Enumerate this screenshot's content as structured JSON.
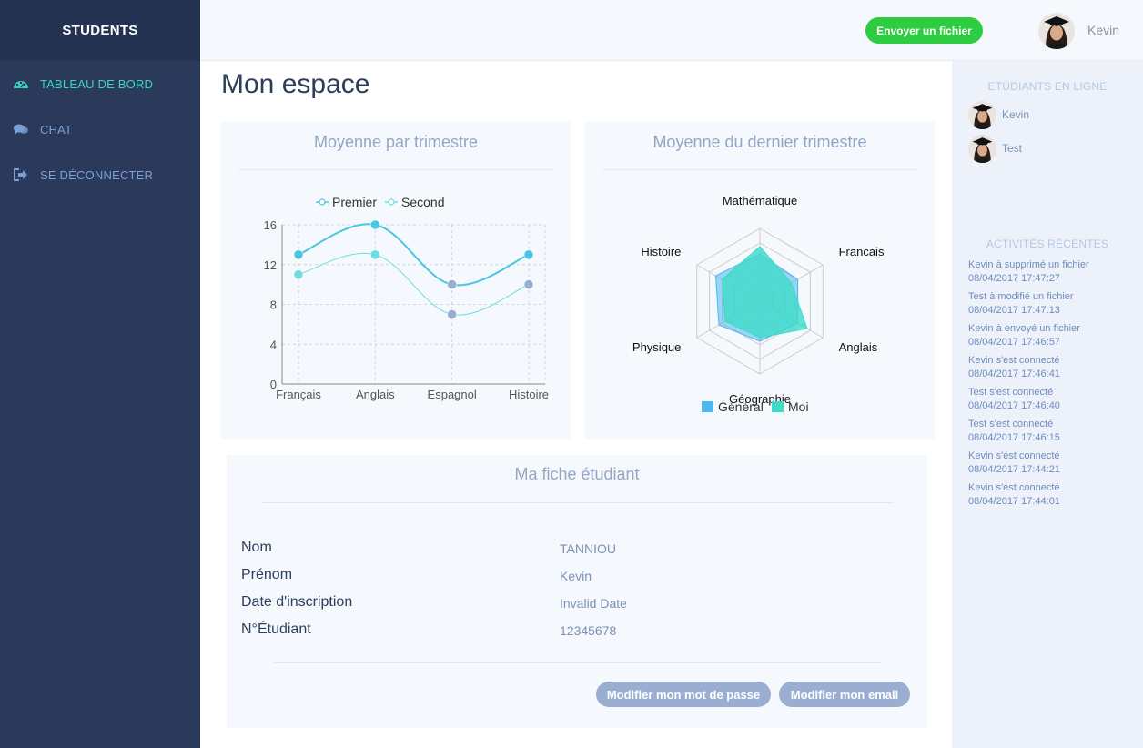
{
  "sidebar": {
    "brand": "STUDENTS",
    "items": [
      {
        "label": "TABLEAU DE BORD",
        "icon": "dashboard-icon",
        "active": true
      },
      {
        "label": "CHAT",
        "icon": "chat-icon",
        "active": false
      },
      {
        "label": "SE DÉCONNECTER",
        "icon": "logout-icon",
        "active": false
      }
    ]
  },
  "topbar": {
    "upload_label": "Envoyer un fichier",
    "user_name": "Kevin"
  },
  "main": {
    "title": "Mon espace",
    "line_card_title": "Moyenne par trimestre",
    "radar_card_title": "Moyenne du dernier trimestre",
    "sheet": {
      "title": "Ma fiche étudiant",
      "rows": [
        {
          "label": "Nom",
          "value": "TANNIOU"
        },
        {
          "label": "Prénom",
          "value": "Kevin"
        },
        {
          "label": "Date d'inscription",
          "value": "Invalid Date"
        },
        {
          "label": "N°Étudiant",
          "value": "12345678"
        }
      ],
      "btn_password": "Modifier mon mot de passe",
      "btn_email": "Modifier mon email"
    }
  },
  "right_panel": {
    "online_title": "ETUDIANTS EN LIGNE",
    "online_users": [
      "Kevin",
      "Test"
    ],
    "activity_title": "ACTIVITÉS RÉCENTES",
    "activities": [
      {
        "text": "Kevin à supprimé un fichier",
        "date": "08/04/2017 17:47:27"
      },
      {
        "text": "Test à modifié un fichier",
        "date": "08/04/2017 17:47:13"
      },
      {
        "text": "Kevin à envoyé un fichier",
        "date": "08/04/2017 17:46:57"
      },
      {
        "text": "Kevin s'est connecté",
        "date": "08/04/2017 17:46:41"
      },
      {
        "text": "Test s'est connecté",
        "date": "08/04/2017 17:46:40"
      },
      {
        "text": "Test s'est connecté",
        "date": "08/04/2017 17:46:15"
      },
      {
        "text": "Kevin s'est connecté",
        "date": "08/04/2017 17:44:21"
      },
      {
        "text": "Kevin s'est connecté",
        "date": "08/04/2017 17:44:01"
      }
    ]
  },
  "colors": {
    "sidebar_bg": "#2b3a5a",
    "accent_teal": "#39d3c4",
    "upload_green": "#2ecc40",
    "series_premier": "#4cc6e0",
    "series_second": "#6fdde0",
    "radar_general": "#4cb8ee",
    "radar_moi": "#3ddbc8"
  },
  "chart_data": [
    {
      "type": "line",
      "categories": [
        "Français",
        "Anglais",
        "Espagnol",
        "Histoire"
      ],
      "series": [
        {
          "name": "Premier",
          "values": [
            13,
            16,
            10,
            13
          ]
        },
        {
          "name": "Second",
          "values": [
            11,
            13,
            7,
            10
          ]
        }
      ],
      "yticks": [
        "0",
        "4",
        "8",
        "12",
        "16"
      ],
      "ylim": [
        0,
        16
      ],
      "grid": true,
      "legend": "top-center"
    },
    {
      "type": "radar",
      "categories": [
        "Mathématique",
        "Francais",
        "Anglais",
        "Géographie",
        "Physique",
        "Histoire"
      ],
      "series": [
        {
          "name": "Général",
          "values": [
            13,
            12,
            12,
            11,
            13,
            14
          ]
        },
        {
          "name": "Moi",
          "values": [
            15,
            10,
            15,
            10,
            11,
            12
          ]
        }
      ],
      "max": 20,
      "legend": "bottom"
    }
  ]
}
